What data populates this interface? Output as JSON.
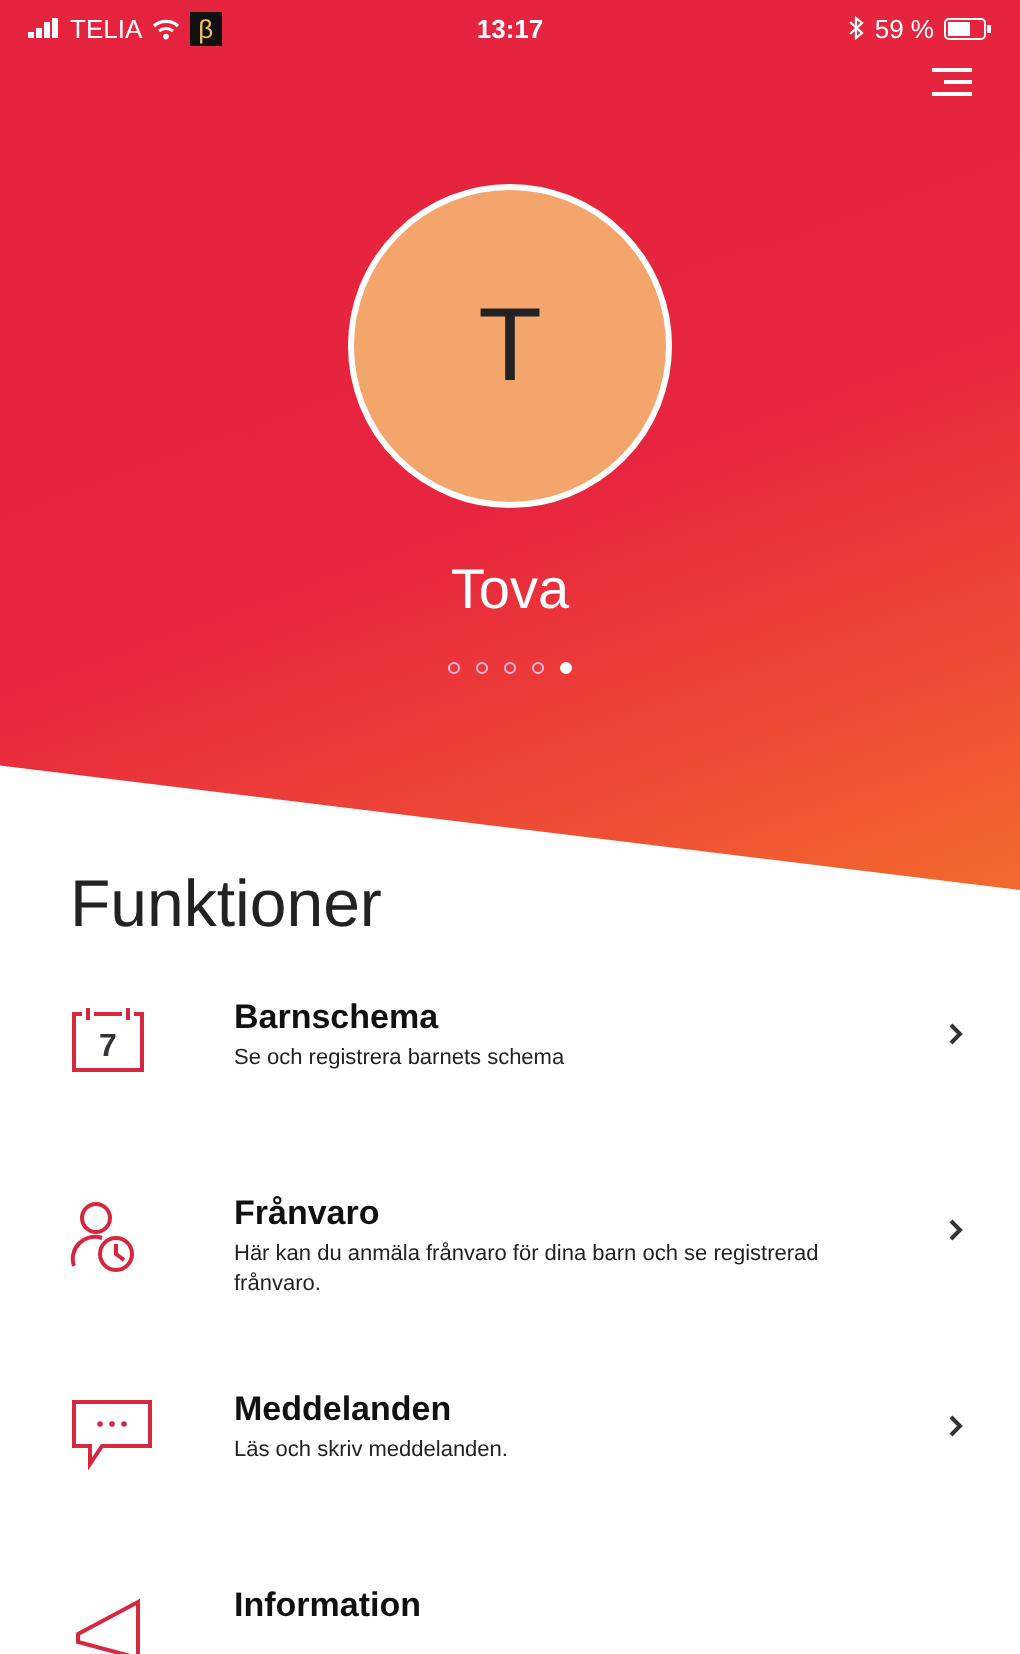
{
  "status_bar": {
    "carrier": "TELIA",
    "tag": "β",
    "time": "13:17",
    "battery": "59 %"
  },
  "profile": {
    "initial": "T",
    "name": "Tova",
    "pages": [
      {
        "selected": false
      },
      {
        "selected": false
      },
      {
        "selected": false
      },
      {
        "selected": false
      },
      {
        "selected": true
      }
    ]
  },
  "section_title": "Funktioner",
  "items": [
    {
      "kind": "calendar",
      "day": "7",
      "title": "Barnschema",
      "description": "Se och registrera barnets schema"
    },
    {
      "kind": "absence",
      "title": "Frånvaro",
      "description": "Här kan du anmäla frånvaro för dina barn och se registrerad frånvaro."
    },
    {
      "kind": "message",
      "title": "Meddelanden",
      "description": "Läs och skriv meddelanden."
    },
    {
      "kind": "info",
      "title": "Information"
    }
  ]
}
